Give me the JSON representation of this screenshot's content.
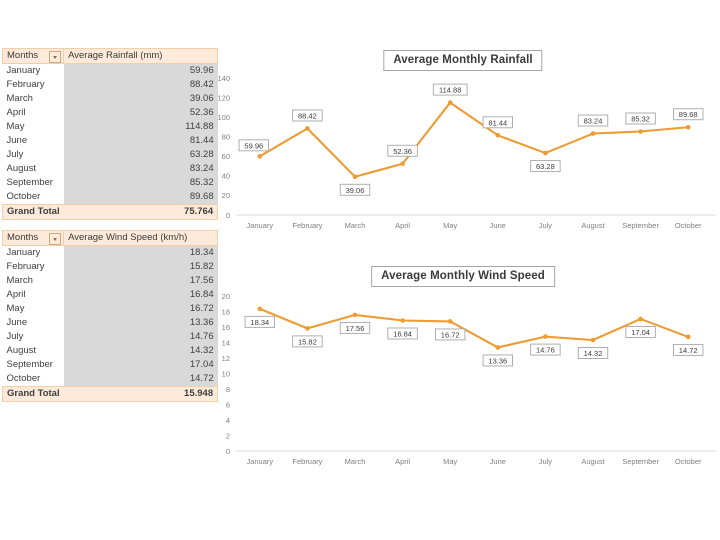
{
  "tables": [
    {
      "id": "rainfall",
      "headers": {
        "month": "Months",
        "value": "Average Rainfall (mm)"
      },
      "filter_icon": "filter-dropdown-icon",
      "rows": [
        {
          "month": "January",
          "value": "59.96"
        },
        {
          "month": "February",
          "value": "88.42"
        },
        {
          "month": "March",
          "value": "39.06"
        },
        {
          "month": "April",
          "value": "52.36"
        },
        {
          "month": "May",
          "value": "114.88"
        },
        {
          "month": "June",
          "value": "81.44"
        },
        {
          "month": "July",
          "value": "63.28"
        },
        {
          "month": "August",
          "value": "83.24"
        },
        {
          "month": "September",
          "value": "85.32"
        },
        {
          "month": "October",
          "value": "89.68"
        }
      ],
      "total": {
        "label": "Grand Total",
        "value": "75.764"
      }
    },
    {
      "id": "wind",
      "headers": {
        "month": "Months",
        "value": "Average Wind Speed (km/h)"
      },
      "filter_icon": "filter-dropdown-icon",
      "rows": [
        {
          "month": "January",
          "value": "18.34"
        },
        {
          "month": "February",
          "value": "15.82"
        },
        {
          "month": "March",
          "value": "17.56"
        },
        {
          "month": "April",
          "value": "16.84"
        },
        {
          "month": "May",
          "value": "16.72"
        },
        {
          "month": "June",
          "value": "13.36"
        },
        {
          "month": "July",
          "value": "14.76"
        },
        {
          "month": "August",
          "value": "14.32"
        },
        {
          "month": "September",
          "value": "17.04"
        },
        {
          "month": "October",
          "value": "14.72"
        }
      ],
      "total": {
        "label": "Grand Total",
        "value": "15.948"
      }
    }
  ],
  "colors": {
    "series": "#ed9b33",
    "header_bg": "#fdeada",
    "value_bg": "#d9d9d9",
    "axis": "#d9d9d9",
    "tick_text": "#7f7f7f"
  },
  "chart_data": [
    {
      "type": "line",
      "title": "Average Monthly Rainfall",
      "xlabel": "",
      "ylabel": "",
      "categories": [
        "January",
        "February",
        "March",
        "April",
        "May",
        "June",
        "July",
        "August",
        "September",
        "October"
      ],
      "values": [
        59.96,
        88.42,
        39.06,
        52.36,
        114.88,
        81.44,
        63.28,
        83.24,
        85.32,
        89.68
      ],
      "data_labels": [
        "59.96",
        "88.42",
        "39.06",
        "52.36",
        "114.88",
        "81.44",
        "63.28",
        "83.24",
        "85.32",
        "89.68"
      ],
      "yticks": [
        0,
        20,
        40,
        60,
        80,
        100,
        120,
        140
      ],
      "ylim": [
        0,
        140
      ],
      "grid": false,
      "legend": "none",
      "series_color": "#ed9b33"
    },
    {
      "type": "line",
      "title": "Average Monthly Wind Speed",
      "xlabel": "",
      "ylabel": "",
      "categories": [
        "January",
        "February",
        "March",
        "April",
        "May",
        "June",
        "July",
        "August",
        "September",
        "October"
      ],
      "values": [
        18.34,
        15.82,
        17.56,
        16.84,
        16.72,
        13.36,
        14.76,
        14.32,
        17.04,
        14.72
      ],
      "data_labels": [
        "18.34",
        "15.82",
        "17.56",
        "16.84",
        "16.72",
        "13.36",
        "14.76",
        "14.32",
        "17.04",
        "14.72"
      ],
      "yticks": [
        0,
        2,
        4,
        6,
        8,
        10,
        12,
        14,
        16,
        18,
        20
      ],
      "ylim": [
        0,
        20
      ],
      "grid": false,
      "legend": "none",
      "series_color": "#ed9b33"
    }
  ],
  "label_offsets": {
    "rainfall": [
      "below-left",
      "above",
      "below",
      "above",
      "above",
      "above",
      "below",
      "above",
      "above",
      "above"
    ],
    "wind": [
      "below",
      "below",
      "below",
      "below",
      "below",
      "below",
      "below",
      "below",
      "below",
      "below"
    ]
  }
}
